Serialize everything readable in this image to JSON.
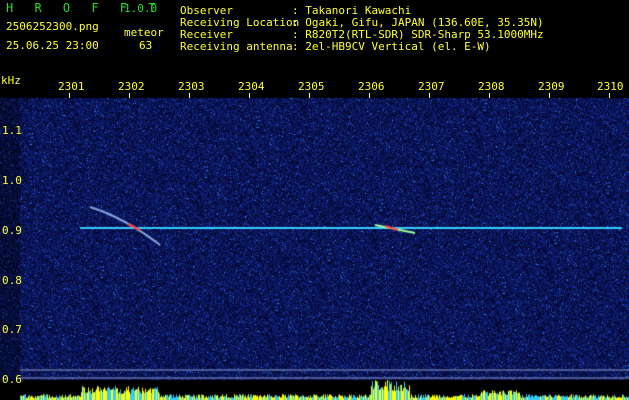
{
  "app": {
    "brand": "H R O F F T",
    "version": "1.0.0",
    "filename": "2506252300.png",
    "datetime": "25.06.25 23:00",
    "count_label": "meteor",
    "count_value": "63"
  },
  "info": {
    "rows": [
      {
        "label": "Observer",
        "value": ": Takanori Kawachi"
      },
      {
        "label": "Receiving Location",
        "value": ": Ogaki, Gifu, JAPAN (136.60E, 35.35N)"
      },
      {
        "label": "Receiver",
        "value": ": R820T2(RTL-SDR) SDR-Sharp 53.1000MHz"
      },
      {
        "label": "Receiving antenna",
        "value": ": 2el-HB9CV Vertical (el. E-W)"
      }
    ]
  },
  "axes": {
    "unit": "kHz",
    "time_ticks": [
      "2301",
      "2302",
      "2303",
      "2304",
      "2305",
      "2306",
      "2307",
      "2308",
      "2309",
      "2310"
    ],
    "freq_ticks": [
      "1.1",
      "1.0",
      "0.9",
      "0.8",
      "0.7",
      "0.6"
    ]
  },
  "colors": {
    "background": "#000000",
    "noise": "#1a2a8a",
    "carrier": "#33ccff",
    "signal": "#ffff00",
    "text_green": "#22dd22",
    "text_yellow": "#ffff33"
  }
}
